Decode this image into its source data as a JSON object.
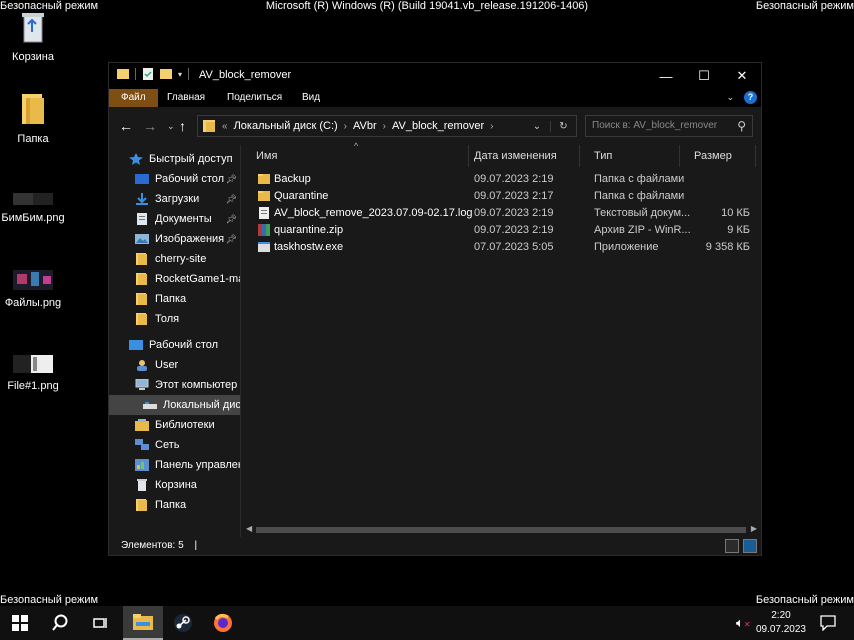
{
  "system": {
    "safe_mode": "Безопасный режим",
    "build": "Microsoft (R) Windows (R) (Build 19041.vb_release.191206-1406)"
  },
  "desktop": {
    "icons": [
      {
        "label": "Корзина",
        "icon": "recycle-bin-icon"
      },
      {
        "label": "Папка",
        "icon": "folder-icon"
      },
      {
        "label": "БимБим.png",
        "icon": "image-file-icon"
      },
      {
        "label": "Файлы.png",
        "icon": "image-file-icon"
      },
      {
        "label": "File#1.png",
        "icon": "image-file-icon"
      }
    ]
  },
  "window": {
    "title": "AV_block_remover",
    "controls": {
      "minimize": "—",
      "maximize": "☐",
      "close": "✕"
    },
    "ribbon": {
      "tabs": [
        "Файл",
        "Главная",
        "Поделиться",
        "Вид"
      ]
    },
    "address": {
      "overflow": "«",
      "segments": [
        "Локальный диск (C:)",
        "AVbr",
        "AV_block_remover"
      ]
    },
    "search_placeholder": "Поиск в: AV_block_remover",
    "nav": {
      "quick_access": "Быстрый доступ",
      "items": [
        {
          "label": "Рабочий стол",
          "pinned": true,
          "icon": "desktop-icon"
        },
        {
          "label": "Загрузки",
          "pinned": true,
          "icon": "downloads-icon"
        },
        {
          "label": "Документы",
          "pinned": true,
          "icon": "documents-icon"
        },
        {
          "label": "Изображения",
          "pinned": true,
          "icon": "pictures-icon"
        },
        {
          "label": "cherry-site",
          "pinned": false,
          "icon": "folder-icon"
        },
        {
          "label": "RocketGame1-main",
          "pinned": false,
          "icon": "folder-icon"
        },
        {
          "label": "Папка",
          "pinned": false,
          "icon": "folder-icon"
        },
        {
          "label": "Толя",
          "pinned": false,
          "icon": "folder-icon"
        }
      ],
      "desktop": "Рабочий стол",
      "tree": [
        {
          "label": "User",
          "icon": "user-icon"
        },
        {
          "label": "Этот компьютер",
          "icon": "computer-icon"
        },
        {
          "label": "Локальный диск",
          "icon": "drive-icon"
        },
        {
          "label": "Библиотеки",
          "icon": "libraries-icon"
        },
        {
          "label": "Сеть",
          "icon": "network-icon"
        },
        {
          "label": "Панель управлени",
          "icon": "control-panel-icon"
        },
        {
          "label": "Корзина",
          "icon": "recycle-bin-icon"
        },
        {
          "label": "Папка",
          "icon": "folder-icon"
        }
      ]
    },
    "columns": {
      "name": "Имя",
      "date": "Дата изменения",
      "type": "Тип",
      "size": "Размер"
    },
    "files": [
      {
        "name": "Backup",
        "date": "09.07.2023 2:19",
        "type": "Папка с файлами",
        "size": "",
        "icon": "folder-icon"
      },
      {
        "name": "Quarantine",
        "date": "09.07.2023 2:17",
        "type": "Папка с файлами",
        "size": "",
        "icon": "folder-icon"
      },
      {
        "name": "AV_block_remove_2023.07.09-02.17.log",
        "date": "09.07.2023 2:19",
        "type": "Текстовый докум...",
        "size": "10 КБ",
        "icon": "text-file-icon"
      },
      {
        "name": "quarantine.zip",
        "date": "09.07.2023 2:19",
        "type": "Архив ZIP - WinR...",
        "size": "9 КБ",
        "icon": "archive-icon"
      },
      {
        "name": "taskhostw.exe",
        "date": "07.07.2023 5:05",
        "type": "Приложение",
        "size": "9 358 КБ",
        "icon": "exe-icon"
      }
    ],
    "status": "Элементов: 5"
  },
  "taskbar": {
    "time": "2:20",
    "date": "09.07.2023"
  }
}
